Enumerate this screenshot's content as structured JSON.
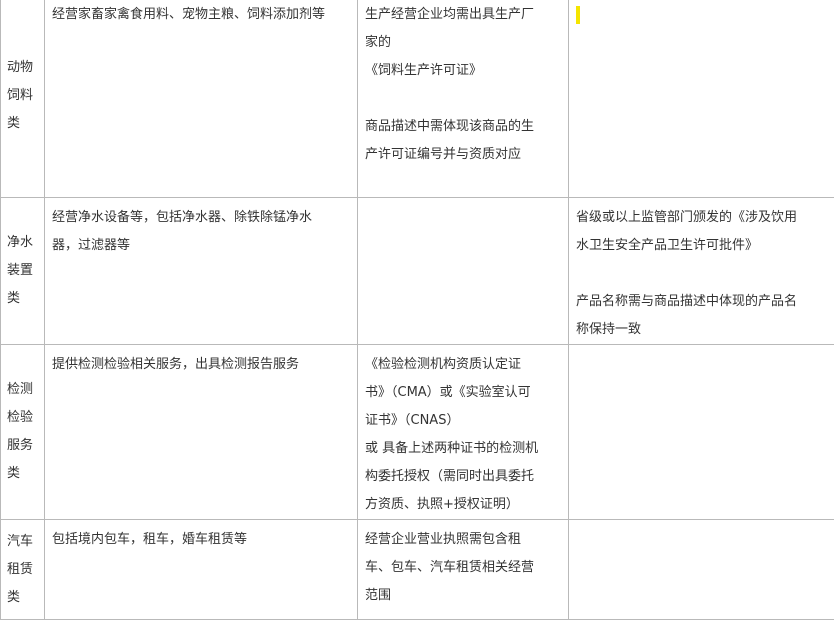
{
  "rows": [
    {
      "category": [
        "动物",
        "饲料",
        "类"
      ],
      "scope": [
        "经营家畜家禽食用料、宠物主粮、饲料添加剂等"
      ],
      "requirement": [
        "生产经营企业均需出具生产厂",
        "家的",
        "《饲料生产许可证》",
        "",
        "商品描述中需体现该商品的生",
        "产许可证编号并与资质对应"
      ],
      "note": []
    },
    {
      "category": [
        "净水",
        "装置",
        "类"
      ],
      "scope": [
        "经营净水设备等，包括净水器、除铁除锰净水",
        "器，过滤器等"
      ],
      "requirement": [],
      "note": [
        "省级或以上监管部门颁发的《涉及饮用",
        "水卫生安全产品卫生许可批件》",
        "",
        "产品名称需与商品描述中体现的产品名",
        "称保持一致"
      ]
    },
    {
      "category": [
        "检测",
        "检验",
        "服务",
        "类"
      ],
      "scope": [
        "提供检测检验相关服务，出具检测报告服务"
      ],
      "requirement": [
        "《检验检测机构资质认定证",
        "书》（CMA）或《实验室认可",
        "证书》（CNAS）",
        "或 具备上述两种证书的检测机",
        "构委托授权（需同时出具委托",
        "方资质、执照+授权证明）"
      ],
      "note": []
    },
    {
      "category": [
        "汽车",
        "租赁",
        "类"
      ],
      "scope": [
        "包括境内包车，租车，婚车租赁等"
      ],
      "requirement": [
        "经营企业营业执照需包含租",
        "车、包车、汽车租赁相关经营",
        "范围"
      ],
      "note": []
    }
  ],
  "colors": {
    "border": "#b9b9b9",
    "text": "#333333",
    "highlight_marker": "#f5e500"
  }
}
